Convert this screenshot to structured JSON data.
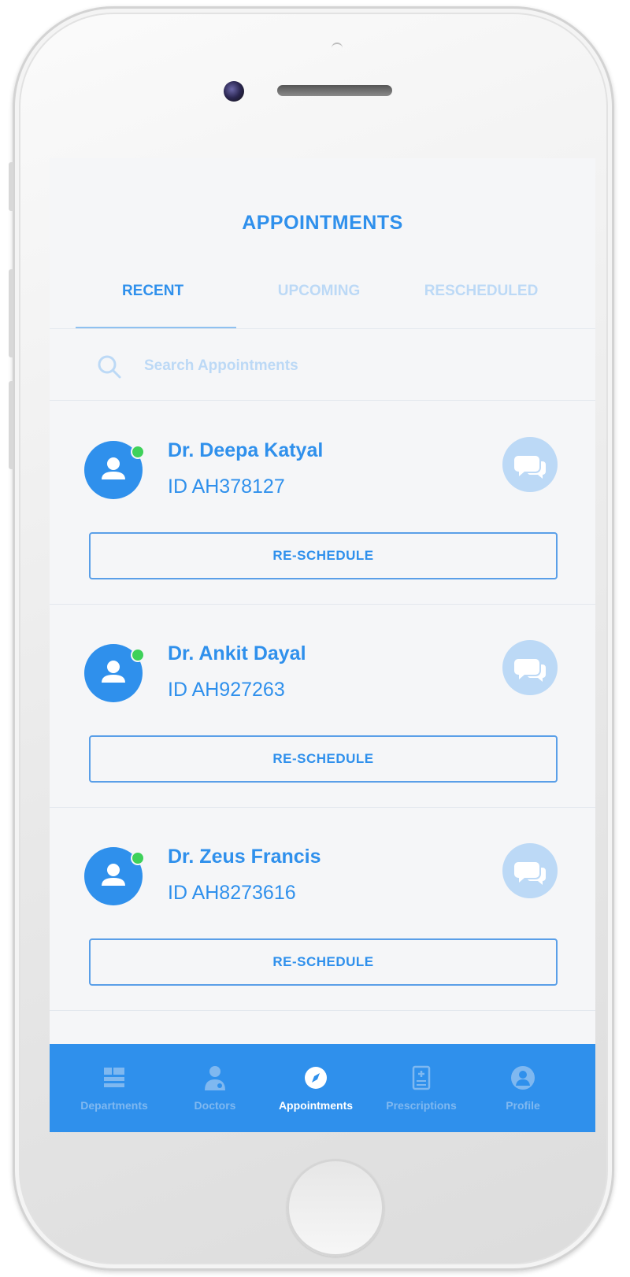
{
  "screen": {
    "title": "APPOINTMENTS",
    "tabs": [
      {
        "label": "RECENT",
        "active": true
      },
      {
        "label": "UPCOMING",
        "active": false
      },
      {
        "label": "RESCHEDULED",
        "active": false
      }
    ],
    "search": {
      "placeholder": "Search Appointments",
      "value": ""
    },
    "appointments": [
      {
        "name": "Dr. Deepa Katyal",
        "id": "ID AH378127",
        "status": "online",
        "action_label": "RE-SCHEDULE"
      },
      {
        "name": "Dr. Ankit Dayal",
        "id": "ID AH927263",
        "status": "online",
        "action_label": "RE-SCHEDULE"
      },
      {
        "name": "Dr. Zeus Francis",
        "id": "ID AH8273616",
        "status": "online",
        "action_label": "RE-SCHEDULE"
      }
    ],
    "bottom_nav": [
      {
        "label": "Departments",
        "icon": "departments-icon",
        "active": false
      },
      {
        "label": "Doctors",
        "icon": "doctor-icon",
        "active": false
      },
      {
        "label": "Appointments",
        "icon": "compass-icon",
        "active": true
      },
      {
        "label": "Prescriptions",
        "icon": "prescription-icon",
        "active": false
      },
      {
        "label": "Profile",
        "icon": "profile-icon",
        "active": false
      }
    ]
  },
  "colors": {
    "primary": "#2f90ec",
    "primary_light": "#bcd9f6",
    "online": "#3ed15a",
    "background": "#f5f6f8"
  }
}
